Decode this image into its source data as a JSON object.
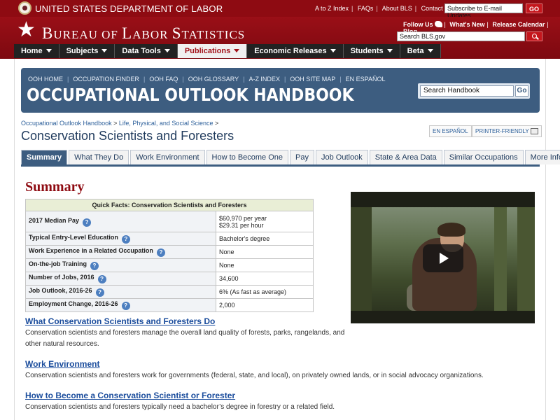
{
  "dol": {
    "title": "UNITED STATES DEPARTMENT OF LABOR",
    "links": [
      "A to Z Index",
      "FAQs",
      "About BLS",
      "Contact Us"
    ],
    "email_placeholder": "Subscribe to E-mail Updates",
    "go_label": "GO"
  },
  "bls": {
    "title_big1": "B",
    "title_small1": "UREAU OF ",
    "title_big2": "L",
    "title_small2": "ABOR ",
    "title_big3": "S",
    "title_small3": "TATISTICS",
    "follow": "Follow Us",
    "util_links": [
      "What's New",
      "Release Calendar",
      "Blog"
    ],
    "search_placeholder": "Search BLS.gov"
  },
  "nav": [
    {
      "label": "Home"
    },
    {
      "label": "Subjects"
    },
    {
      "label": "Data Tools"
    },
    {
      "label": "Publications"
    },
    {
      "label": "Economic Releases"
    },
    {
      "label": "Students"
    },
    {
      "label": "Beta"
    }
  ],
  "ooh": {
    "links": [
      "OOH HOME",
      "OCCUPATION FINDER",
      "OOH FAQ",
      "OOH GLOSSARY",
      "A-Z INDEX",
      "OOH SITE MAP",
      "EN ESPAÑOL"
    ],
    "title": "OCCUPATIONAL OUTLOOK HANDBOOK",
    "search_placeholder": "Search Handbook",
    "search_go": "Go"
  },
  "breadcrumb": {
    "crumb1": "Occupational Outlook Handbook",
    "crumb2": "Life, Physical, and Social Science",
    "sep": ">"
  },
  "page_title": "Conservation Scientists and Foresters",
  "en_espanol": "EN ESPAÑOL",
  "printer_friendly": "PRINTER-FRIENDLY",
  "tabs": [
    {
      "label": "Summary"
    },
    {
      "label": "What They Do"
    },
    {
      "label": "Work Environment"
    },
    {
      "label": "How to Become One"
    },
    {
      "label": "Pay"
    },
    {
      "label": "Job Outlook"
    },
    {
      "label": "State & Area Data"
    },
    {
      "label": "Similar Occupations"
    },
    {
      "label": "More Info"
    }
  ],
  "summary_heading": "Summary",
  "quick_facts": {
    "header": "Quick Facts: Conservation Scientists and Foresters",
    "rows": [
      {
        "label": "2017 Median Pay",
        "value": "$60,970 per year",
        "value2": "$29.31 per hour"
      },
      {
        "label": "Typical Entry-Level Education",
        "value": "Bachelor's degree"
      },
      {
        "label": "Work Experience in a Related Occupation",
        "value": "None"
      },
      {
        "label": "On-the-job Training",
        "value": "None"
      },
      {
        "label": "Number of Jobs, 2016",
        "value": "34,600"
      },
      {
        "label": "Job Outlook, 2016-26",
        "value": "6% (As fast as average)"
      },
      {
        "label": "Employment Change, 2016-26",
        "value": "2,000"
      }
    ],
    "help_glyph": "?"
  },
  "sections": [
    {
      "link": "What Conservation Scientists and Foresters Do",
      "text": "Conservation scientists and foresters manage the overall land quality of forests, parks, rangelands, and other natural resources."
    },
    {
      "link": "Work Environment",
      "text": "Conservation scientists and foresters work for governments (federal, state, and local), on privately owned lands, or in social advocacy organizations."
    },
    {
      "link": "How to Become a Conservation Scientist or Forester",
      "text": "Conservation scientists and foresters typically need a bachelor’s degree in forestry or a related field."
    }
  ]
}
